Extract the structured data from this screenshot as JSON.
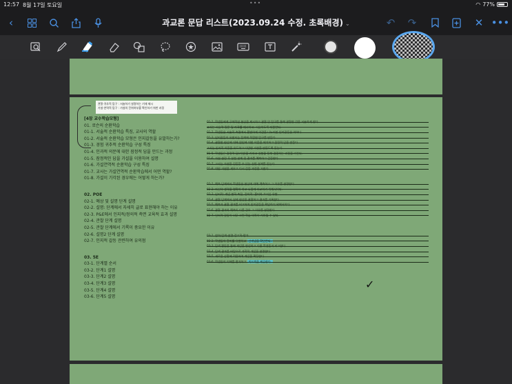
{
  "status": {
    "time": "12:57",
    "date": "8월 17일 토요일",
    "battery": "77%",
    "battery_level": 0.77
  },
  "titlebar": {
    "title": "과교론 문답 리스트(2023.09.24 수정. 초록배경)",
    "icons": [
      "back-chevron-icon",
      "grid-icon",
      "search-icon",
      "share-icon",
      "microphone-icon",
      "undo-icon",
      "redo-icon",
      "bookmark-icon",
      "add-page-icon",
      "close-icon",
      "more-icon"
    ]
  },
  "toolbar": {
    "tools": [
      "lasso-search-icon",
      "pen-icon",
      "highlighter-icon",
      "eraser-icon",
      "shapes-icon",
      "lasso-icon",
      "sticker-icon",
      "image-icon",
      "keyboard-icon",
      "text-box-icon",
      "laser-pointer-icon"
    ],
    "colors": [
      "#e5e5e5",
      "#ffffff",
      "#d8d8d8"
    ]
  },
  "document": {
    "page_color": "#7fa877",
    "note_box": [
      "관찰·귀추적 탐구 : 서술하기 설명하는 기재 제시",
      "가설·연역적 탐구 : 가설의 진위여부를 확인하기 위한 과정"
    ],
    "left_sections": [
      {
        "heading": "[4장 교수학습모형]",
        "items": [
          "01. 로슨의 순환학습",
          "01-1. 서술적 순환학습 특징, 교사의 역할",
          "01-2. 서술적 순환학습 모형은 인지갈등을 유발하는가?",
          "01-3. 경험 귀추적 순환학습 구성 특징",
          "01-4. 인과적 의문에 대한 잠정적 답을 만드는 과정",
          "01-5. 잠정적인 답을 가설을 이용하여 설명",
          "01-6. 가설연역적 순환학습 구성 특징",
          "01-7. 교사는 가설연역적 순환학습에서 어떤 역할?",
          "01-8. 가설이 기각된 경우에는 어떻게 하는가?"
        ]
      },
      {
        "heading": "02. POE",
        "items": [
          "02-1. 예상 및 설명 단계 설명",
          "02-2. 설명: 단계에서 자세히 글로 표현해야 하는 이유",
          "02-3. P&E에서 인지적/정의적 측면 교육적 효과 설명",
          "02-4. 관찰 단계 설명",
          "02-5. 관찰 단계에서 기록이 중요한 이유",
          "02-6. 설명2 단계 설명",
          "02-7. 인지적 갈등 관련하여 유의점"
        ]
      },
      {
        "heading": "03. 5E",
        "items": [
          "03-1. 단계별 순서",
          "03-2. 단계1 설명",
          "03-3. 단계2 설명",
          "03-4. 단계3 설명",
          "03-5. 단계4 설명",
          "03-6. 단계5 설명"
        ]
      }
    ],
    "right_sections": [
      {
        "lines": [
          "01-1. 학생들에게 구체적인 현상을 제시하고 관찰 및 탐구를 통해 관찰한 것을 서술하게 한다.",
          "교사는 서술적 질문 및 자료를 제시하고, 서술하도록 지원한다.",
          "01-2. 학생들은 서술적 측면에서 활발하게 의견을 나누지만 인지갈등은 약하다.",
          "01-3. 인지갈등이 유발되는 탐색에 적합한 탐구를 만든다.",
          "01-4. 관찰한 현상에 대해 원인에 대한 의문을 제기하고 잠정적 답을 만든다.",
          "교사는 인과적 의문을 유도하고 다양한 가설을 만들도록 돕는다.",
          "01-5. 학생들은 잠정적 답(가설)을 가지고 실험을 통해 검증하는 과정을 거친다.",
          "01-6. 가설 설정 후 실험 설계 및 결과를 예측하고 검증한다.",
          "01-7. 교사는 가설을 검증할 수 있는 실험 설계를 돕는다.",
          "01-8. 대안 가설을 세우고 다시 검증 과정을 거친다."
        ]
      },
      {
        "lines": [
          "02-1. 예측 단계에서 학생들은 현상에 대해 예측하고 그 이유를 설명한다.",
          "02-2. 자신의 생각을 명확히 하고 나중에 비교하기 위해서이다.",
          "02-3. 인지적: 개념 변화 촉진, 정의적: 흥미와 호기심 유발",
          "02-4. 관찰 단계에서 실제 현상을 관찰하고 결과를 기록한다.",
          "02-5. 예측과 관찰 결과를 비교하여 인지갈등을 확인하기 위해서이다.",
          "02-6. 관찰 결과와 예측이 다를 경우 그 이유를 설명한다.",
          "02-7. 인지적 갈등이 너무 크면 학습 의욕이 저하될 수 있다."
        ]
      },
      {
        "lines": [
          "03-1. 참여-탐색-설명-정교화-평가",
          "03-2. 학생들의 흥미를 유발하고 선개념을 확인한다.",
          "03-3. 탐색 활동을 통해 개념을 형성하고 다른 학생들과 비교한다.",
          "03-4. 탐색 결과를 바탕으로 과학적 개념을 설명한다.",
          "03-5. 새로운 상황에 적용하여 개념을 확장한다.",
          "03-6. 학생들의 이해를 평가하고 피드백을 제공한다."
        ]
      }
    ],
    "highlights": [
      "선개념을 확인한다.",
      "결과를 다른 학생들과 비교하고",
      "피드백을 제공한다."
    ]
  }
}
